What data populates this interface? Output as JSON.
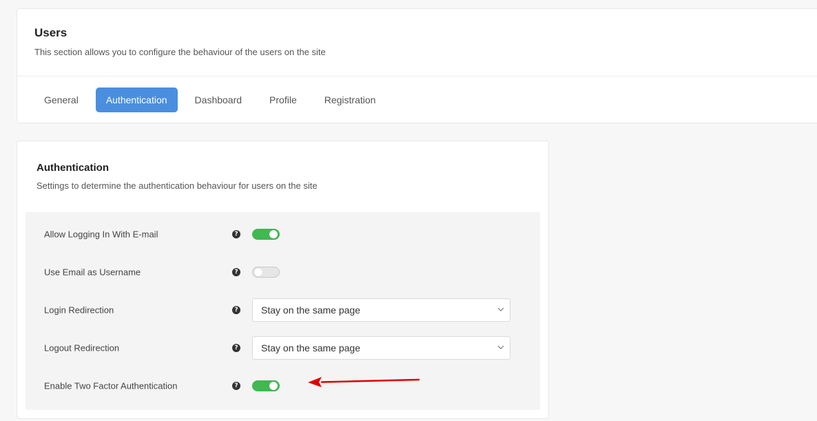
{
  "users": {
    "title": "Users",
    "description": "This section allows you to configure the behaviour of the users on the site",
    "tabs": [
      {
        "label": "General",
        "active": false
      },
      {
        "label": "Authentication",
        "active": true
      },
      {
        "label": "Dashboard",
        "active": false
      },
      {
        "label": "Profile",
        "active": false
      },
      {
        "label": "Registration",
        "active": false
      }
    ]
  },
  "authentication": {
    "title": "Authentication",
    "description": "Settings to determine the authentication behaviour for users on the site",
    "settings": [
      {
        "label": "Allow Logging In With E-mail",
        "type": "toggle",
        "value": true
      },
      {
        "label": "Use Email as Username",
        "type": "toggle",
        "value": false
      },
      {
        "label": "Login Redirection",
        "type": "select",
        "value": "Stay on the same page"
      },
      {
        "label": "Logout Redirection",
        "type": "select",
        "value": "Stay on the same page"
      },
      {
        "label": "Enable Two Factor Authentication",
        "type": "toggle",
        "value": true
      }
    ],
    "help_icon": "question-circle-icon"
  },
  "colors": {
    "accent": "#4a8ee0",
    "toggle_on": "#3fb950",
    "annotation_arrow": "#e00000"
  }
}
